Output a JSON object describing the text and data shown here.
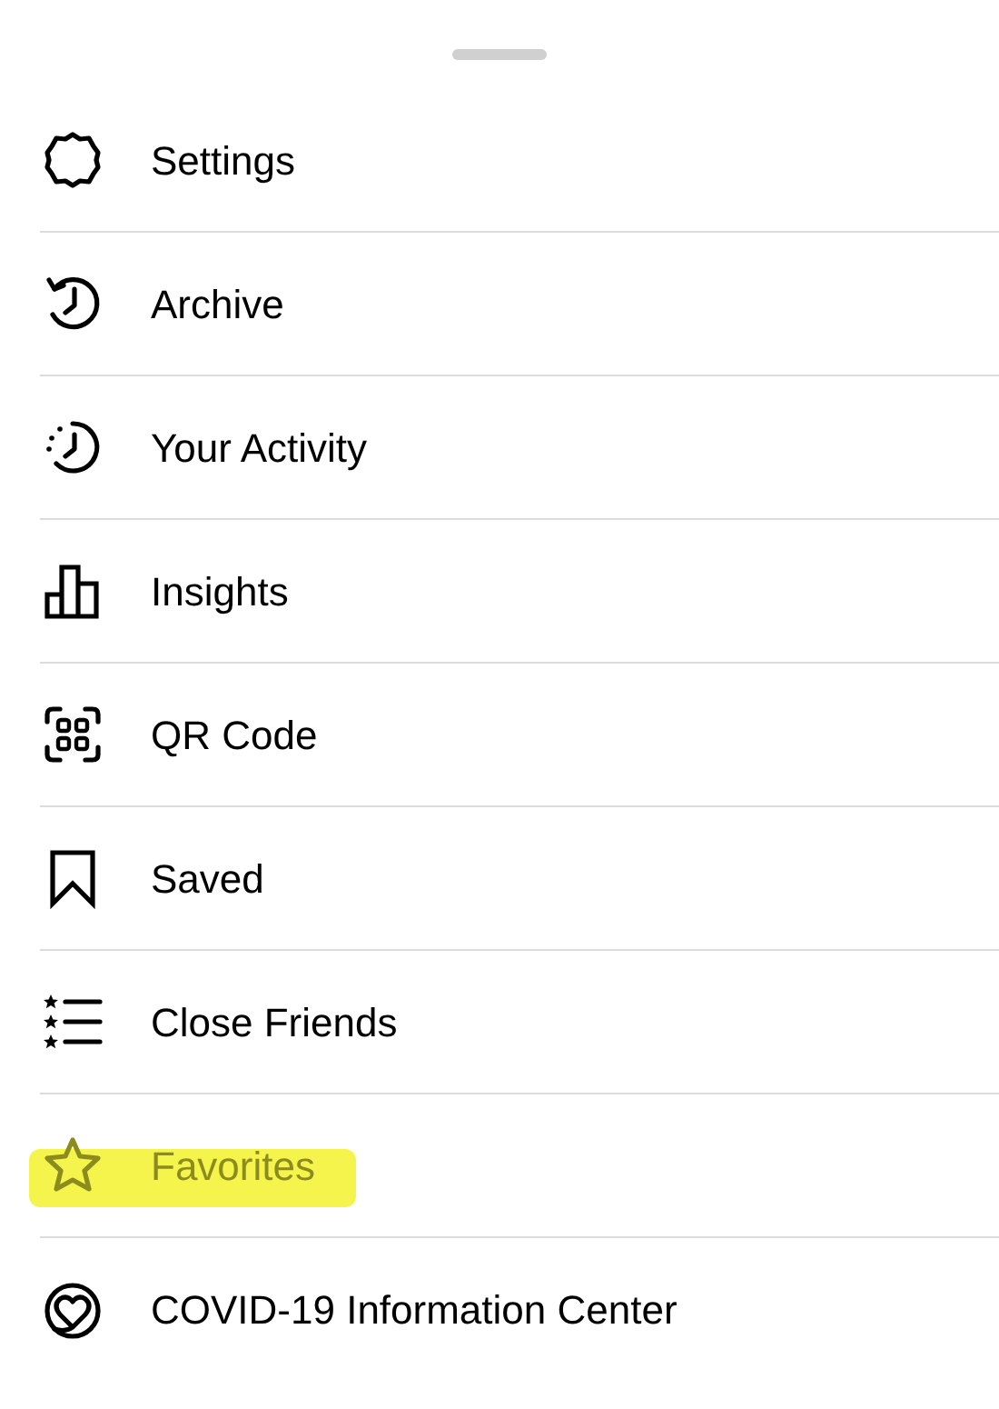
{
  "menu": {
    "items": [
      {
        "label": "Settings",
        "highlighted": false
      },
      {
        "label": "Archive",
        "highlighted": false
      },
      {
        "label": "Your Activity",
        "highlighted": false
      },
      {
        "label": "Insights",
        "highlighted": false
      },
      {
        "label": "QR Code",
        "highlighted": false
      },
      {
        "label": "Saved",
        "highlighted": false
      },
      {
        "label": "Close Friends",
        "highlighted": false
      },
      {
        "label": "Favorites",
        "highlighted": true
      },
      {
        "label": "COVID-19 Information Center",
        "highlighted": false
      }
    ]
  }
}
